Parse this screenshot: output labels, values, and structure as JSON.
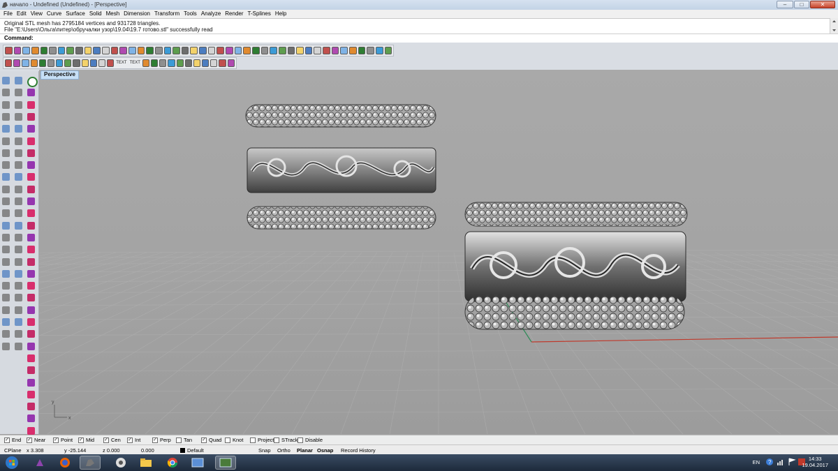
{
  "window": {
    "title": "начало - Undefined (Undefined) - [Perspective]",
    "controls": {
      "minimize": "–",
      "maximize": "□",
      "close": "✕"
    }
  },
  "menu": [
    "File",
    "Edit",
    "View",
    "Curve",
    "Surface",
    "Solid",
    "Mesh",
    "Dimension",
    "Transform",
    "Tools",
    "Analyze",
    "Render",
    "T-Splines",
    "Help"
  ],
  "history": {
    "line1": "Original STL mesh has 2795184 vertices and 931728 triangles.",
    "line2": "File \"E:\\Users\\Ольга\\питер\\обручалки узор\\19.04\\19.7 готово.stl\" successfully read"
  },
  "command": {
    "label": "Command:"
  },
  "toolbar": {
    "text_label_1": "TEXT",
    "text_label_2": "TEXT"
  },
  "viewport": {
    "tab": "Perspective",
    "axis_x": "x",
    "axis_y": "y"
  },
  "osnap": [
    {
      "label": "End",
      "checked": true
    },
    {
      "label": "Near",
      "checked": true
    },
    {
      "label": "Point",
      "checked": true
    },
    {
      "label": "Mid",
      "checked": true
    },
    {
      "label": "Cen",
      "checked": true
    },
    {
      "label": "Int",
      "checked": true
    },
    {
      "label": "Perp",
      "checked": true
    },
    {
      "label": "Tan",
      "checked": false
    },
    {
      "label": "Quad",
      "checked": true
    },
    {
      "label": "Knot",
      "checked": false
    },
    {
      "label": "Project",
      "checked": false
    },
    {
      "label": "STrack",
      "checked": false
    },
    {
      "label": "Disable",
      "checked": false
    }
  ],
  "status": {
    "cplane": "CPlane",
    "x": "x 3.308",
    "y": "y -25.144",
    "z": "z 0.000",
    "value": "0.000",
    "layer": "Default",
    "snap": "Snap",
    "ortho": "Ortho",
    "planar": "Planar",
    "osnap": "Osnap",
    "record": "Record History"
  },
  "taskbar": {
    "lang": "EN",
    "time": "14:33",
    "date": "19.04.2017"
  },
  "colors": {
    "viewport_bg": "#a3a3a3",
    "x_axis": "#c0392b",
    "y_axis": "#2e8b57",
    "tab_bg": "#c7dff5"
  }
}
